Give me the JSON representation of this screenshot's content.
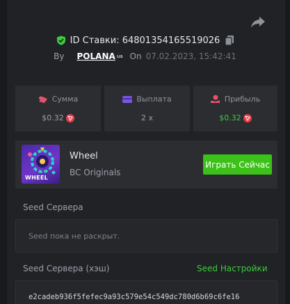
{
  "header": {
    "share_icon": "share-arrow-icon",
    "bet_id_label": "ID Ставки: 64801354165519026",
    "shield_icon": "shield-check-icon",
    "copy_icon": "copy-icon",
    "by_label": "By",
    "username": "POLANA",
    "user_flag": "ua",
    "on_label": "On",
    "date": "07.02.2023, 15:42:41"
  },
  "stats": [
    {
      "label": "Сумма",
      "value": "$0.32",
      "icon": "coins-icon"
    },
    {
      "label": "Выплата",
      "value": "2 x",
      "icon": "wallet-icon"
    },
    {
      "label": "Прибыль",
      "value": "$0.32",
      "icon": "profit-icon"
    }
  ],
  "game": {
    "name": "Wheel",
    "provider": "BC Originals",
    "thumb_text": "WHEEL",
    "play_label": "Играть Сейчас"
  },
  "seed_server": {
    "label": "Seed Сервера",
    "value": "Seed пока не раскрыт."
  },
  "seed_hash": {
    "label": "Seed Сервера (хэш)",
    "settings_label": "Seed Настройки",
    "value": "e2cadeb936f5fefec9a93c579e54c549dc780d6b69c6fe16"
  },
  "colors": {
    "accent_green": "#3bc117",
    "profit_green": "#3dcc3a",
    "coin_red": "#ec3b4c",
    "icon_pink": "#e8516a",
    "icon_purple": "#7a56e8"
  }
}
